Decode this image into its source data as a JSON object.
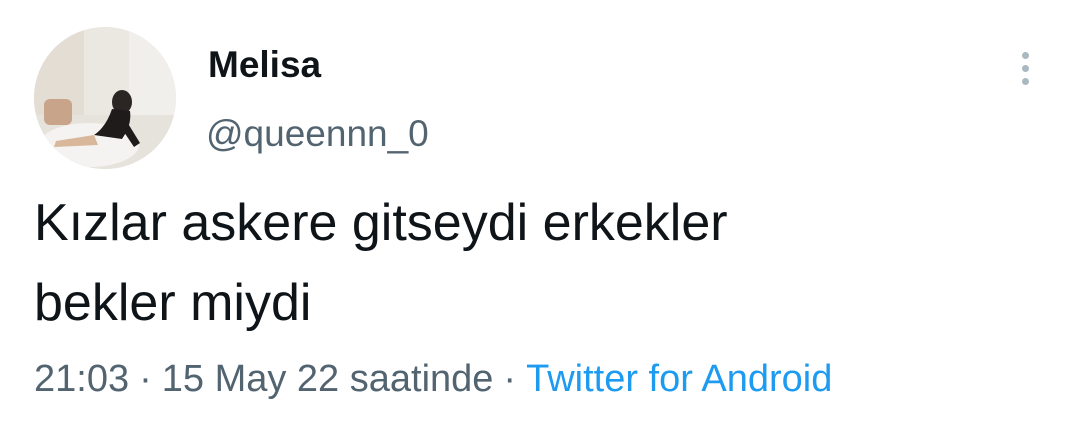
{
  "author": {
    "display_name": "Melisa",
    "handle": "@queennn_0"
  },
  "tweet": {
    "text_line1": "Kızlar askere gitseydi erkekler",
    "text_line2": "bekler miydi"
  },
  "meta": {
    "time": "21:03",
    "separator": "·",
    "date_text": "15 May 22 saatinde",
    "source": "Twitter for Android"
  },
  "icons": {
    "more": "more-vertical-icon"
  },
  "colors": {
    "text": "#0f1419",
    "secondary": "#536471",
    "link": "#1d9bf0"
  }
}
